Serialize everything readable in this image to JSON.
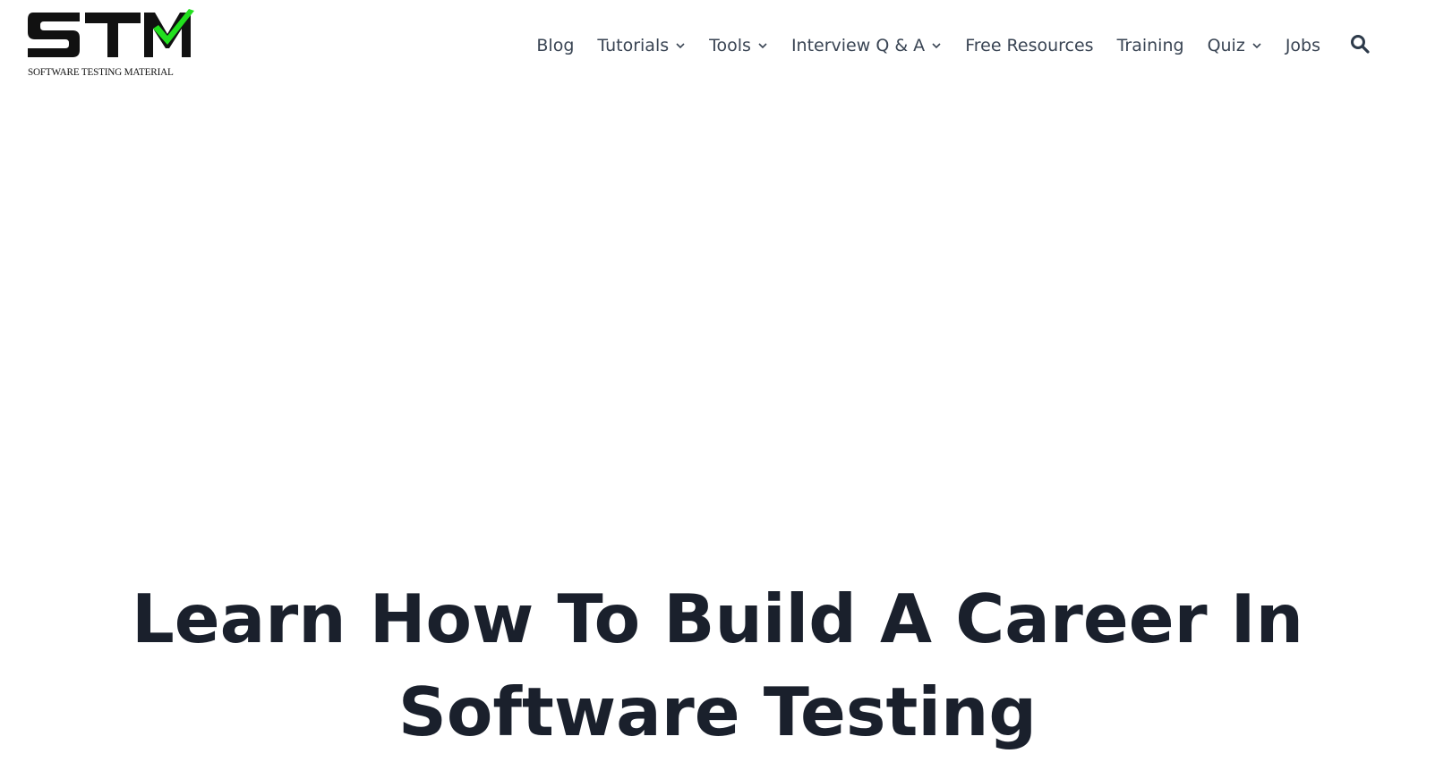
{
  "logo": {
    "letters": "STM",
    "tagline": "SOFTWARE TESTING MATERIAL",
    "check_color": "#22e01e",
    "letter_color": "#111111"
  },
  "nav": {
    "items": [
      {
        "label": "Blog",
        "has_dropdown": false
      },
      {
        "label": "Tutorials",
        "has_dropdown": true
      },
      {
        "label": "Tools",
        "has_dropdown": true
      },
      {
        "label": "Interview Q & A",
        "has_dropdown": true
      },
      {
        "label": "Free Resources",
        "has_dropdown": false
      },
      {
        "label": "Training",
        "has_dropdown": false
      },
      {
        "label": "Quiz",
        "has_dropdown": true
      },
      {
        "label": "Jobs",
        "has_dropdown": false
      }
    ],
    "search_icon": "search-icon"
  },
  "hero": {
    "title_line1": "Learn How To Build A Career In",
    "title_line2": "Software Testing"
  },
  "colors": {
    "nav_text": "#3a4554",
    "heading": "#1a202c",
    "background": "#ffffff"
  }
}
